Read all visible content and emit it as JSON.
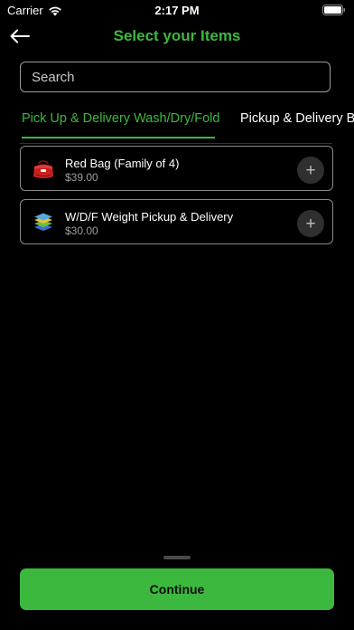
{
  "status_bar": {
    "carrier": "Carrier",
    "time": "2:17 PM"
  },
  "header": {
    "title": "Select your Items"
  },
  "search": {
    "placeholder": "Search",
    "value": ""
  },
  "tabs": [
    {
      "label": "Pick Up & Delivery Wash/Dry/Fold",
      "active": true
    },
    {
      "label": "Pickup & Delivery Be",
      "active": false
    }
  ],
  "items": [
    {
      "name": "Red Bag (Family of 4)",
      "price": "$39.00",
      "icon": "red-bag-icon"
    },
    {
      "name": "W/D/F Weight Pickup & Delivery",
      "price": "$30.00",
      "icon": "folded-laundry-icon"
    }
  ],
  "footer": {
    "continue_label": "Continue"
  },
  "colors": {
    "accent": "#3cb83f",
    "background": "#000000",
    "card_border": "#8a8a8a",
    "price_text": "#9e9e9e"
  }
}
